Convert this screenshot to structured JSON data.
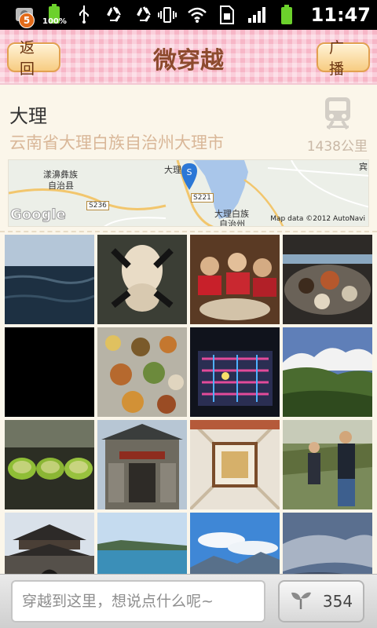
{
  "status_bar": {
    "notification_count": "5",
    "battery_percent": "100%",
    "time": "11:47"
  },
  "header": {
    "title": "微穿越",
    "back_label": "返回",
    "broadcast_label": "广播"
  },
  "location": {
    "name": "大理",
    "address": "云南省大理白族自治州大理市",
    "distance": "1438公里",
    "transport_icon": "train-icon"
  },
  "map": {
    "labels": [
      "漾濞彝族",
      "自治县",
      "大理",
      "大理白族",
      "自治州",
      "宾"
    ],
    "road_shields": [
      "S221",
      "S236"
    ],
    "pin_letter": "S",
    "brand": "Google",
    "attribution": "Map data ©2012 AutoNavi"
  },
  "photos": [
    {
      "desc": "lake water"
    },
    {
      "desc": "selfie portrait"
    },
    {
      "desc": "group dining"
    },
    {
      "desc": "dinner table"
    },
    {
      "desc": "dark photo"
    },
    {
      "desc": "dishes on table"
    },
    {
      "desc": "neon lights"
    },
    {
      "desc": "mountain landscape"
    },
    {
      "desc": "tea cups"
    },
    {
      "desc": "old gate"
    },
    {
      "desc": "painted ceiling"
    },
    {
      "desc": "people outdoors"
    },
    {
      "desc": "ancient tower"
    },
    {
      "desc": "lake shore"
    },
    {
      "desc": "mountains and clouds"
    },
    {
      "desc": "cloudy sky"
    }
  ],
  "composer": {
    "placeholder": "穿越到这里，想说点什么呢~",
    "sprout_count": "354"
  },
  "colors": {
    "title_text": "#8d4b2e",
    "address_text": "#d9b798",
    "header_pink": "#f7b6c7"
  }
}
